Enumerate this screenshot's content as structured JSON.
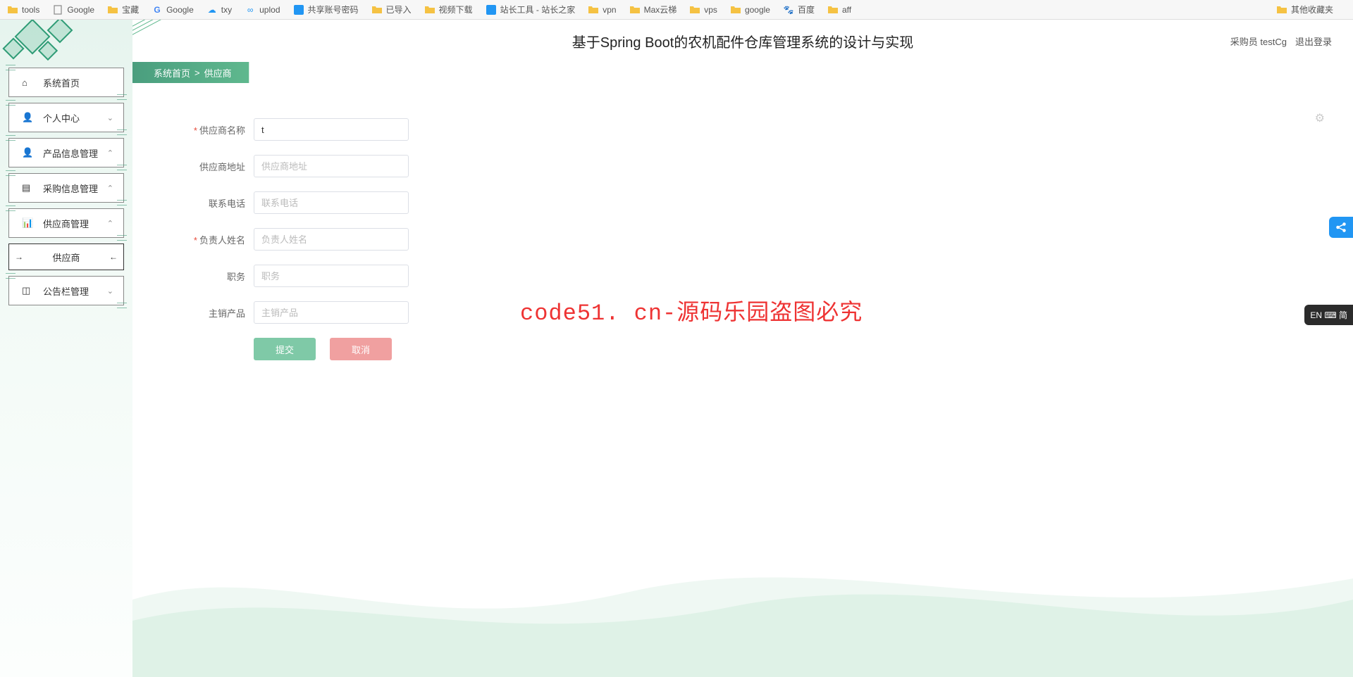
{
  "bookmarks": {
    "left": [
      {
        "label": "tools",
        "type": "folder"
      },
      {
        "label": "Google",
        "type": "page"
      },
      {
        "label": "宝藏",
        "type": "folder"
      },
      {
        "label": "Google",
        "type": "gicon"
      },
      {
        "label": "txy",
        "type": "cloud"
      },
      {
        "label": "uplod",
        "type": "link"
      },
      {
        "label": "共享账号密码",
        "type": "blue"
      },
      {
        "label": "已导入",
        "type": "folder"
      },
      {
        "label": "视频下载",
        "type": "folder"
      },
      {
        "label": "站长工具 - 站长之家",
        "type": "blue"
      },
      {
        "label": "vpn",
        "type": "folder"
      },
      {
        "label": "Max云梯",
        "type": "folder"
      },
      {
        "label": "vps",
        "type": "folder"
      },
      {
        "label": "google",
        "type": "folder"
      },
      {
        "label": "百度",
        "type": "baidu"
      },
      {
        "label": "aff",
        "type": "folder"
      }
    ],
    "right": {
      "label": "其他收藏夹",
      "type": "folder"
    }
  },
  "header": {
    "title": "基于Spring Boot的农机配件仓库管理系统的设计与实现",
    "user": "采购员 testCg",
    "logout": "退出登录"
  },
  "breadcrumb": {
    "home": "系统首页",
    "sep": ">",
    "current": "供应商"
  },
  "sidebar": {
    "items": [
      {
        "label": "系统首页",
        "icon": "home",
        "expand": ""
      },
      {
        "label": "个人中心",
        "icon": "user",
        "expand": "⌄"
      },
      {
        "label": "产品信息管理",
        "icon": "user2",
        "expand": "⌃"
      },
      {
        "label": "采购信息管理",
        "icon": "list",
        "expand": "⌃"
      },
      {
        "label": "供应商管理",
        "icon": "chart",
        "expand": "⌃"
      },
      {
        "label": "公告栏管理",
        "icon": "grid",
        "expand": "⌄"
      }
    ],
    "subitem": "供应商"
  },
  "form": {
    "fields": [
      {
        "label": "供应商名称",
        "required": true,
        "placeholder": "",
        "value": "t"
      },
      {
        "label": "供应商地址",
        "required": false,
        "placeholder": "供应商地址",
        "value": ""
      },
      {
        "label": "联系电话",
        "required": false,
        "placeholder": "联系电话",
        "value": ""
      },
      {
        "label": "负责人姓名",
        "required": true,
        "placeholder": "负责人姓名",
        "value": ""
      },
      {
        "label": "职务",
        "required": false,
        "placeholder": "职务",
        "value": ""
      },
      {
        "label": "主销产品",
        "required": false,
        "placeholder": "主销产品",
        "value": ""
      }
    ],
    "submit": "提交",
    "cancel": "取消"
  },
  "watermark": "code51. cn-源码乐园盗图必究",
  "float": {
    "dark": "EN ⌨ 简"
  }
}
